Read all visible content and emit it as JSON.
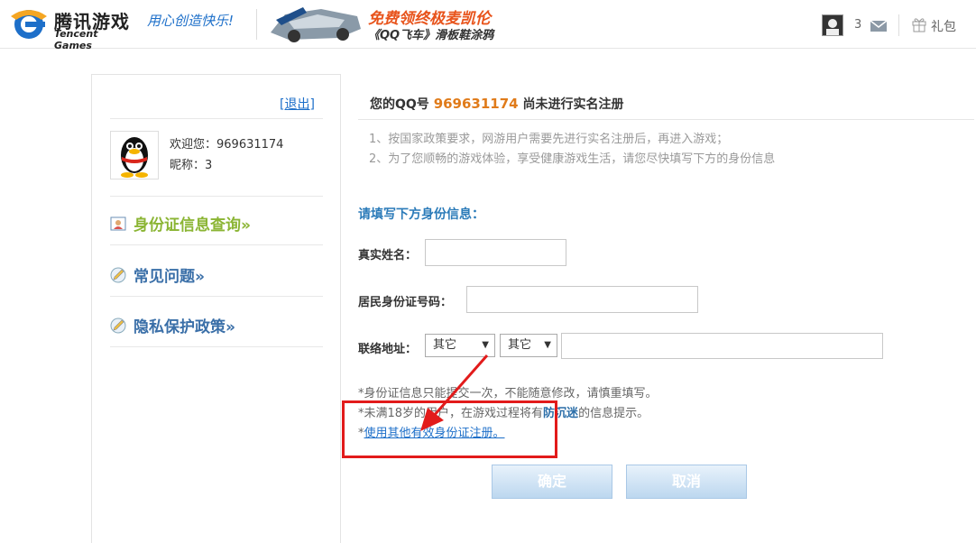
{
  "header": {
    "logo_cn": "腾讯游戏",
    "logo_en": "Tencent Games",
    "slogan": "用心创造快乐!",
    "promo_line1": "免费领终极麦凯伦",
    "promo_line2": "《QQ飞车》滑板鞋涂鸦",
    "message_count": "3",
    "gift_label": "礼包"
  },
  "sidebar": {
    "logout": "[退出]",
    "welcome": "欢迎您：969631174",
    "nickname": "昵称：3",
    "links": [
      {
        "label": "身份证信息查询»"
      },
      {
        "label": "常见问题»"
      },
      {
        "label": "隐私保护政策»"
      }
    ]
  },
  "main": {
    "title_prefix": "您的QQ号",
    "qq_number": "969631174",
    "title_suffix": "尚未进行实名注册",
    "notices": [
      "1、按国家政策要求，网游用户需要先进行实名注册后，再进入游戏；",
      "2、为了您顺畅的游戏体验，享受健康游戏生活，请您尽快填写下方的身份信息"
    ],
    "section_head": "请填写下方身份信息：",
    "fields": {
      "name_label": "真实姓名：",
      "name_value": "",
      "id_label": "居民身份证号码：",
      "id_value": "",
      "addr_label": "联络地址：",
      "province_selected": "其它",
      "city_selected": "其它",
      "addr_value": ""
    },
    "tips": {
      "tip1": "*身份证信息只能提交一次，不能随意修改，请慎重填写。",
      "tip2_pre": "*未满18岁的用户，在游戏过程将有",
      "tip2_bold": "防沉迷",
      "tip2_post": "的信息提示。",
      "tip3_star": "*",
      "tip3_link": "使用其他有效身份证注册。"
    },
    "buttons": {
      "confirm": "确定",
      "cancel": "取消"
    }
  },
  "colors": {
    "accent_blue": "#2b7bb9",
    "qq_orange": "#e07b1a",
    "link_green": "#8bb534",
    "annotation_red": "#e21b1b"
  }
}
